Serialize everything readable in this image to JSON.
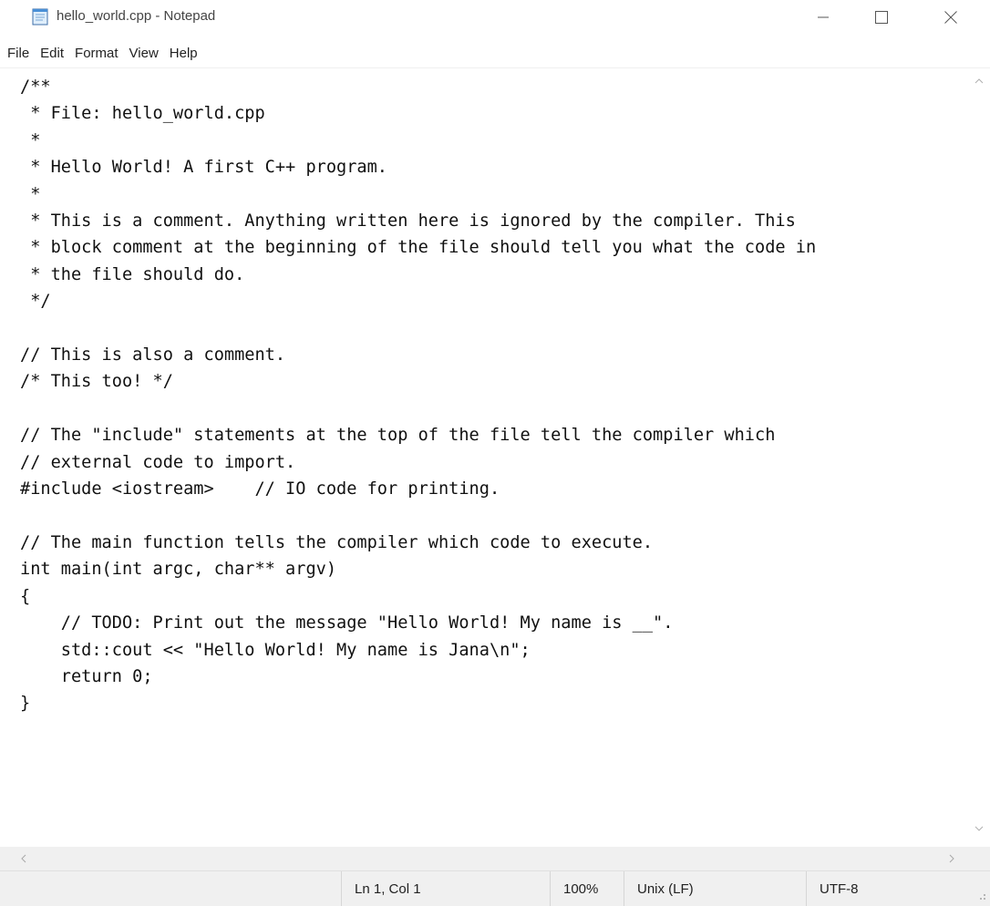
{
  "window": {
    "title": "hello_world.cpp - Notepad",
    "app_icon": "notepad-icon"
  },
  "menu": {
    "file": "File",
    "edit": "Edit",
    "format": "Format",
    "view": "View",
    "help": "Help"
  },
  "editor": {
    "content": "/**\n * File: hello_world.cpp\n *\n * Hello World! A first C++ program.\n *\n * This is a comment. Anything written here is ignored by the compiler. This\n * block comment at the beginning of the file should tell you what the code in\n * the file should do.\n */\n\n// This is also a comment.\n/* This too! */\n\n// The \"include\" statements at the top of the file tell the compiler which\n// external code to import.\n#include <iostream>    // IO code for printing.\n\n// The main function tells the compiler which code to execute.\nint main(int argc, char** argv)\n{\n    // TODO: Print out the message \"Hello World! My name is __\".\n    std::cout << \"Hello World! My name is Jana\\n\";\n    return 0;\n}"
  },
  "status": {
    "position": "Ln 1, Col 1",
    "zoom": "100%",
    "line_ending": "Unix (LF)",
    "encoding": "UTF-8"
  },
  "colors": {
    "statusbar_bg": "#f0f0f0",
    "text": "#111111"
  }
}
